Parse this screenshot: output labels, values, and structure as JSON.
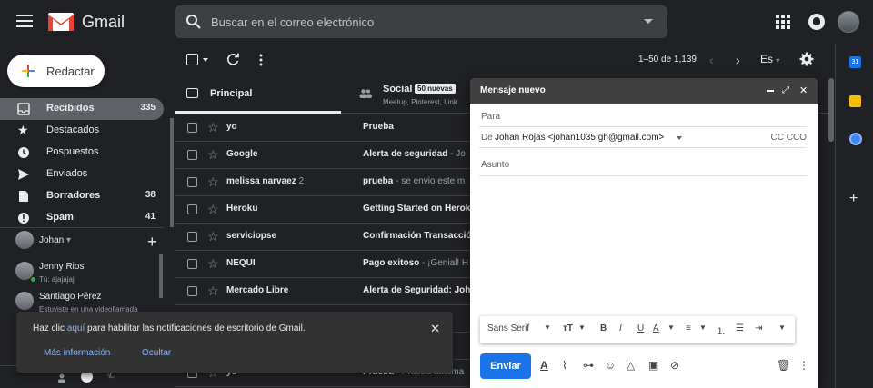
{
  "header": {
    "brand": "Gmail",
    "search_placeholder": "Buscar en el correo electrónico"
  },
  "nav": {
    "compose_label": "Redactar",
    "items": [
      {
        "label": "Recibidos",
        "count": "335"
      },
      {
        "label": "Destacados",
        "count": ""
      },
      {
        "label": "Pospuestos",
        "count": ""
      },
      {
        "label": "Enviados",
        "count": ""
      },
      {
        "label": "Borradores",
        "count": "38"
      },
      {
        "label": "Spam",
        "count": "41"
      }
    ]
  },
  "hangouts": {
    "user": "Johan",
    "contacts": [
      {
        "name": "Jenny Rios",
        "sub": "Tú: ajajajaj"
      },
      {
        "name": "Santiago Pérez",
        "sub": "Estuviste en una videollamada"
      }
    ]
  },
  "toolbar": {
    "pager": "1–50 de 1,139",
    "lang": "Es"
  },
  "tabs": {
    "principal": "Principal",
    "social": "Social",
    "social_badge": "50 nuevas",
    "social_sub": "Meetup, Pinterest, Link"
  },
  "emails": [
    {
      "sender": "yo",
      "count": "",
      "subject": "Prueba",
      "snippet": ""
    },
    {
      "sender": "Google",
      "count": "",
      "subject": "Alerta de seguridad",
      "snippet": " - Jo"
    },
    {
      "sender": "melissa narvaez",
      "count": " 2",
      "subject": "prueba",
      "snippet": " - se envio este m"
    },
    {
      "sender": "Heroku",
      "count": "",
      "subject": "Getting Started on Herok",
      "snippet": ""
    },
    {
      "sender": "serviciopse",
      "count": "",
      "subject": "Confirmación Transacció",
      "snippet": ""
    },
    {
      "sender": "NEQUI",
      "count": "",
      "subject": "Pago exitoso",
      "snippet": " - ¡Genial! H"
    },
    {
      "sender": "Mercado Libre",
      "count": "",
      "subject": "Alerta de Seguridad: Joh",
      "snippet": ""
    },
    {
      "sender": "",
      "count": "",
      "subject": "",
      "snippet": ""
    },
    {
      "sender": "",
      "count": "",
      "subject": "",
      "snippet": ""
    },
    {
      "sender": "yo",
      "count": "",
      "subject": "Prueba",
      "snippet": " - Prueba automa"
    }
  ],
  "compose": {
    "title": "Mensaje nuevo",
    "to_label": "Para",
    "from_label": "De",
    "from_value": "Johan Rojas <johan1035.gh@gmail.com>",
    "cc_label": "CC CCO",
    "subject_label": "Asunto",
    "font": "Sans Serif",
    "send_label": "Enviar"
  },
  "snackbar": {
    "text_before": "Haz clic ",
    "link": "aquí",
    "text_after": " para habilitar las notificaciones de escritorio de Gmail.",
    "more": "Más información",
    "hide": "Ocultar"
  },
  "colors": {
    "background": "#202124",
    "send_button": "#1a73e8",
    "active_nav": "#5f6368",
    "link": "#8ab4f8"
  }
}
